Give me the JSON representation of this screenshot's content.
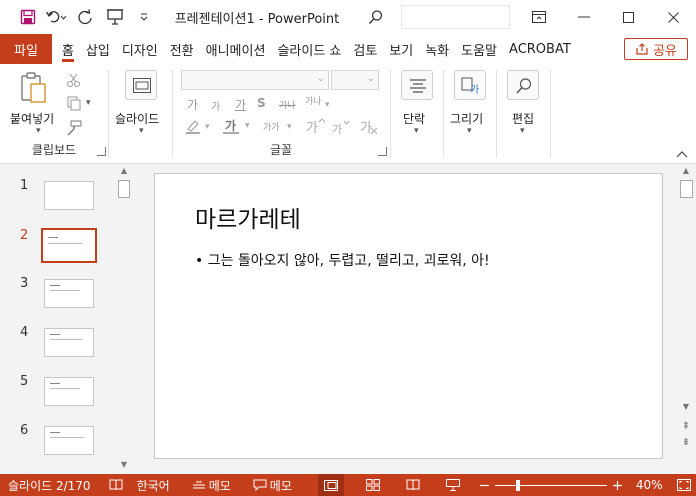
{
  "window": {
    "title": "프레젠테이션1  -  PowerPoint"
  },
  "tabs": [
    {
      "label": "파일",
      "active": false,
      "file": true
    },
    {
      "label": "홈",
      "active": true
    },
    {
      "label": "삽입",
      "active": false
    },
    {
      "label": "디자인",
      "active": false
    },
    {
      "label": "전환",
      "active": false
    },
    {
      "label": "애니메이션",
      "active": false
    },
    {
      "label": "슬라이드 쇼",
      "active": false
    },
    {
      "label": "검토",
      "active": false
    },
    {
      "label": "보기",
      "active": false
    },
    {
      "label": "녹화",
      "active": false
    },
    {
      "label": "도움말",
      "active": false
    },
    {
      "label": "ACROBAT",
      "active": false
    }
  ],
  "share": {
    "label": "공유"
  },
  "ribbon": {
    "clipboard": {
      "paste_label": "붙여넣기",
      "group_label": "클립보드"
    },
    "slides": {
      "slide_label": "슬라이드"
    },
    "font": {
      "group_label": "글꼴",
      "size_up": "가",
      "size_down": "가",
      "bold_sample": "가",
      "italic_sample": "가",
      "underline_sample": "가",
      "shadow_sample": "S",
      "strike_sample": "가나",
      "spacing_sample": "가나",
      "highlight_sample": "가",
      "color_sample": "가",
      "case_sample": "가가"
    },
    "paragraph": {
      "label": "단락"
    },
    "drawing": {
      "label": "그리기"
    },
    "editing": {
      "label": "편집"
    }
  },
  "thumbnails": [
    {
      "num": "1",
      "active": false
    },
    {
      "num": "2",
      "active": true
    },
    {
      "num": "3",
      "active": false
    },
    {
      "num": "4",
      "active": false
    },
    {
      "num": "5",
      "active": false
    },
    {
      "num": "6",
      "active": false
    }
  ],
  "slide": {
    "title": "마르가레테",
    "bullet": "• 그는 돌아오지 않아, 두렵고, 떨리고, 괴로워, 아!"
  },
  "statusbar": {
    "slide_count": "슬라이드 2/170",
    "language": "한국어",
    "notes": "메모",
    "comments": "메모",
    "zoom": "40%",
    "zoom_fraction": 0.2
  },
  "colors": {
    "accent": "#c43e1c"
  }
}
